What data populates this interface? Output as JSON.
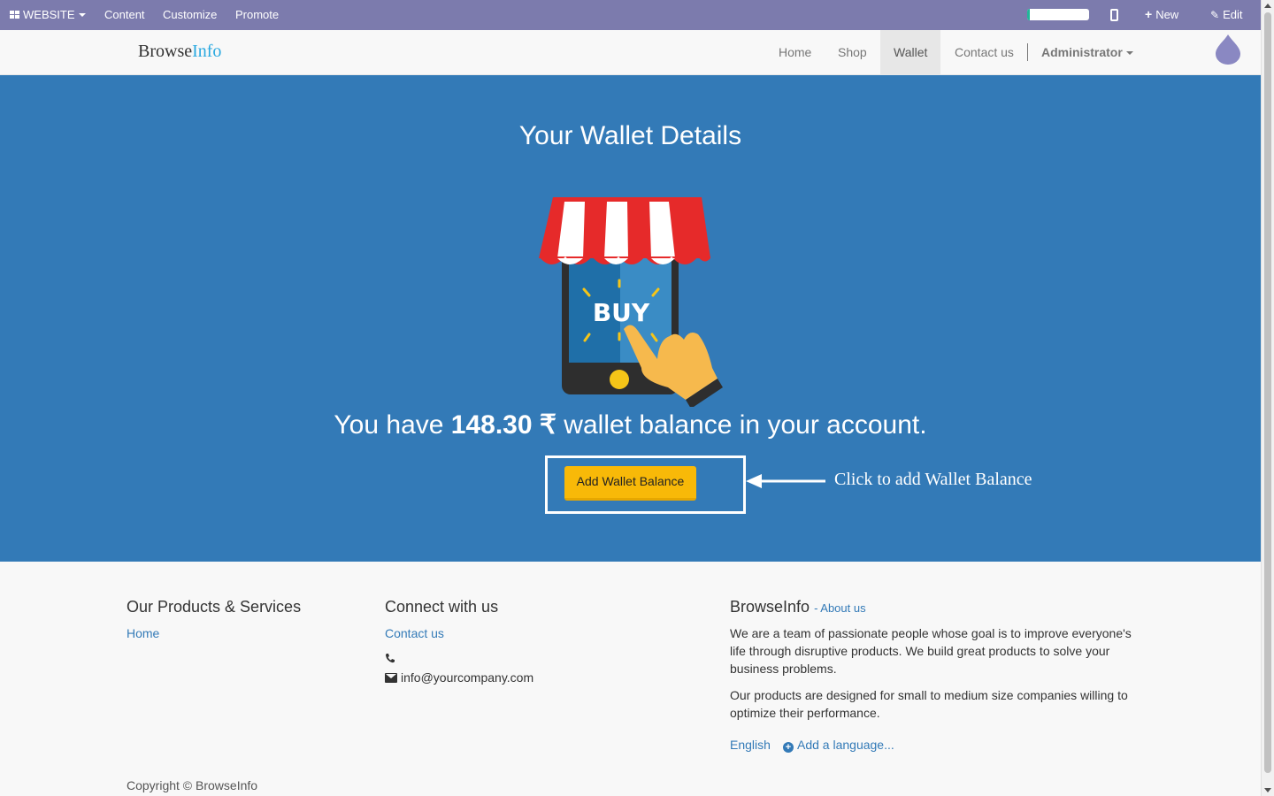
{
  "adminbar": {
    "apps_label": "WEBSITE",
    "menu": [
      "Content",
      "Customize",
      "Promote"
    ],
    "progress_fraction": 0.04,
    "new_label": "New",
    "edit_label": "Edit",
    "bg_color": "#7c7bad"
  },
  "navbar": {
    "brand_part1": "Browse",
    "brand_part2": "Info",
    "links": [
      "Home",
      "Shop",
      "Wallet",
      "Contact us"
    ],
    "active_link": "Wallet",
    "user": "Administrator"
  },
  "hero": {
    "title": "Your Wallet Details",
    "illustration_text": "BUY",
    "balance_prefix": "You have ",
    "balance_amount": "148.30 ₹",
    "balance_suffix": " wallet balance in your account.",
    "button_label": "Add Wallet Balance",
    "callout": "Click to add Wallet Balance",
    "bg_color": "#337ab7",
    "button_color": "#f8b908"
  },
  "footer": {
    "col1": {
      "title": "Our Products & Services",
      "links": [
        "Home"
      ]
    },
    "col2": {
      "title": "Connect with us",
      "contact_link": "Contact us",
      "phone": "",
      "email": "info@yourcompany.com"
    },
    "col3": {
      "title": "BrowseInfo",
      "about_link": "- About us",
      "para1": "We are a team of passionate people whose goal is to improve everyone's life through disruptive products. We build great products to solve your business problems.",
      "para2": "Our products are designed for small to medium size companies willing to optimize their performance.",
      "language": "English",
      "add_language": "Add a language..."
    },
    "copyright": "Copyright © BrowseInfo"
  }
}
